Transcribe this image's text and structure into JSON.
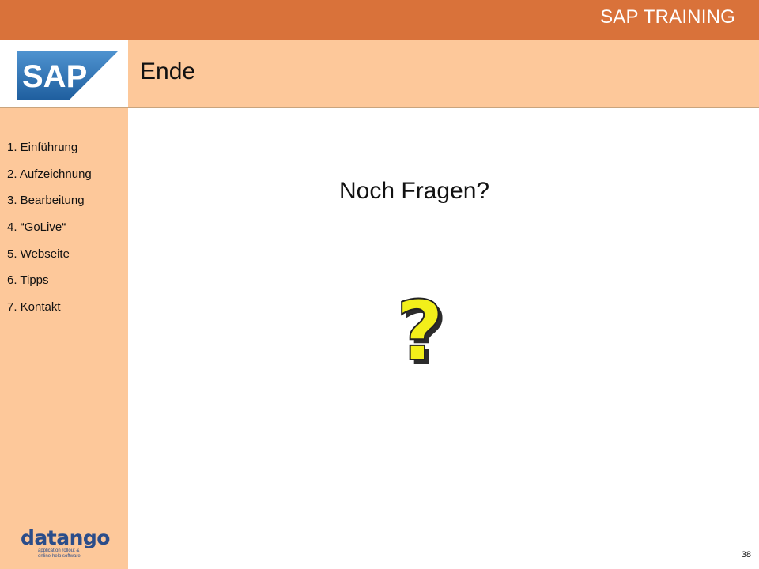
{
  "header": {
    "brand": "SAP TRAINING",
    "logo_text": "SAP",
    "title": "Ende"
  },
  "sidebar": {
    "items": [
      {
        "label": "1. Einführung"
      },
      {
        "label": "2. Aufzeichnung"
      },
      {
        "label": "3. Bearbeitung"
      },
      {
        "label": "4. “GoLive“"
      },
      {
        "label": "5. Webseite"
      },
      {
        "label": "6. Tipps"
      },
      {
        "label": "7. Kontakt"
      }
    ],
    "footer_logo": {
      "name": "datango",
      "tagline_line1": "application rollout &",
      "tagline_line2": "online-help software"
    }
  },
  "main": {
    "question": "Noch Fragen?",
    "question_icon": "question-mark-icon",
    "question_icon_color": "#f2ef1a"
  },
  "footer": {
    "page_number": "38"
  },
  "colors": {
    "topbar": "#d9723a",
    "header_bg": "#fdc89a",
    "sap_logo_blue": "#1f6fb5",
    "datango_blue": "#2b4d8a"
  }
}
